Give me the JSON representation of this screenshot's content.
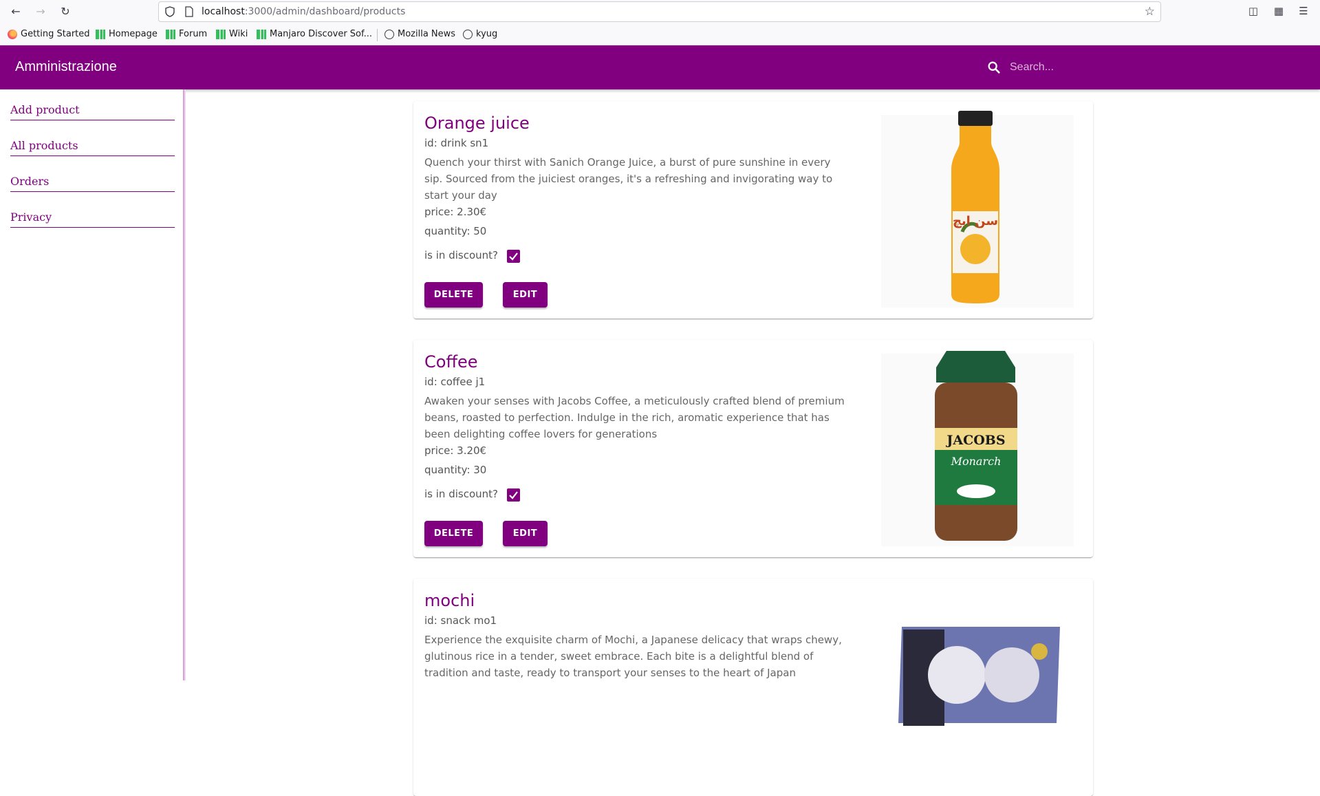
{
  "browser": {
    "url_host": "localhost",
    "url_path": ":3000/admin/dashboard/products",
    "bookmarks": [
      "Getting Started",
      "Homepage",
      "Forum",
      "Wiki",
      "Manjaro Discover Sof...",
      "Mozilla News",
      "kyug"
    ]
  },
  "appbar": {
    "title": "Amministrazione",
    "search_placeholder": "Search..."
  },
  "sidebar": {
    "items": [
      {
        "label": "Add product"
      },
      {
        "label": "All products"
      },
      {
        "label": "Orders"
      },
      {
        "label": "Privacy"
      }
    ]
  },
  "products": [
    {
      "name": "Orange juice",
      "id": "id: drink sn1",
      "description": "Quench your thirst with Sanich Orange Juice, a burst of pure sunshine in every sip. Sourced from the juiciest oranges, it's a refreshing and invigorating way to start your day",
      "price": "price: 2.30€",
      "quantity": "quantity: 50",
      "discount_label": "is in discount?",
      "discount": true,
      "delete_label": "DELETE",
      "edit_label": "EDIT"
    },
    {
      "name": "Coffee",
      "id": "id: coffee j1",
      "description": "Awaken your senses with Jacobs Coffee, a meticulously crafted blend of premium beans, roasted to perfection. Indulge in the rich, aromatic experience that has been delighting coffee lovers for generations",
      "price": "price: 3.20€",
      "quantity": "quantity: 30",
      "discount_label": "is in discount?",
      "discount": true,
      "delete_label": "DELETE",
      "edit_label": "EDIT"
    },
    {
      "name": "mochi",
      "id": "id: snack mo1",
      "description": "Experience the exquisite charm of Mochi, a Japanese delicacy that wraps chewy, glutinous rice in a tender, sweet embrace. Each bite is a delightful blend of tradition and taste, ready to transport your senses to the heart of Japan",
      "image_labels": [
        "JACOBS",
        "Monarch"
      ]
    }
  ],
  "colors": {
    "primary": "#800080"
  }
}
